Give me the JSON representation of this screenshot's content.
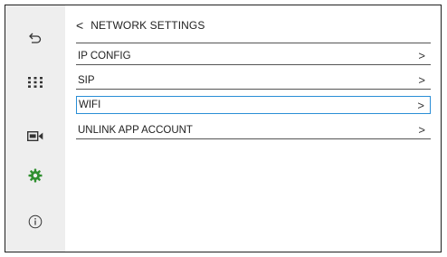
{
  "accent_color": "#2a8ed6",
  "active_icon_color": "#2f8f2f",
  "sidebar": {
    "items": [
      {
        "icon": "back-icon"
      },
      {
        "icon": "apps-grid-icon"
      },
      {
        "icon": "video-camera-icon"
      },
      {
        "icon": "settings-gear-icon",
        "active": true
      },
      {
        "icon": "info-icon"
      }
    ]
  },
  "header": {
    "back_glyph": "<",
    "title": "NETWORK SETTINGS"
  },
  "menu": {
    "chevron": ">",
    "items": [
      {
        "label": "IP CONFIG"
      },
      {
        "label": "SIP"
      },
      {
        "label": "WIFI",
        "selected": true
      },
      {
        "label": "UNLINK APP ACCOUNT"
      }
    ]
  }
}
